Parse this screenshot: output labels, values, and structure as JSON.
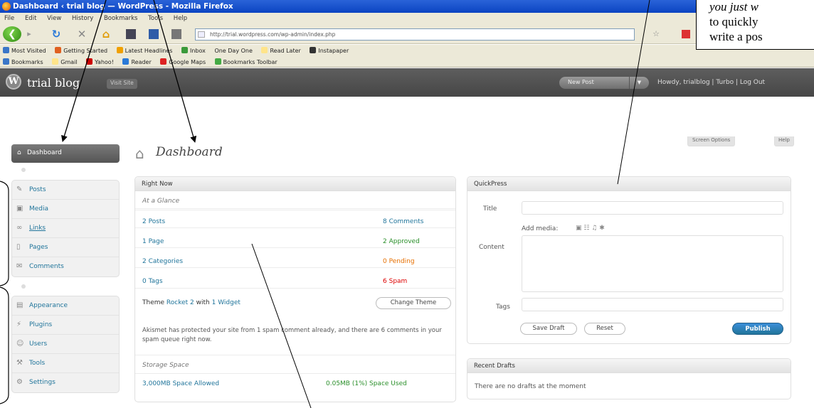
{
  "browser": {
    "title": "Dashboard ‹ trial blog — WordPress - Mozilla Firefox",
    "menu": [
      "File",
      "Edit",
      "View",
      "History",
      "Bookmarks",
      "Tools",
      "Help"
    ],
    "url": "http://trial.wordpress.com/wp-admin/index.php",
    "bookmarks_row1": [
      "Most Visited",
      "Getting Started",
      "Latest Headlines",
      "Inbox",
      "One Day One",
      "Read Later",
      "Instapaper"
    ],
    "bookmarks_row2": [
      "Bookmarks",
      "Gmail",
      "Yahoo!",
      "Reader",
      "Google Maps",
      "Bookmarks Toolbar"
    ]
  },
  "wp_header": {
    "logo": "W",
    "site_title": "trial blog",
    "visit_site": "Visit Site",
    "new_post": "New Post",
    "howdy": "Howdy, trialblog | Turbo | Log Out"
  },
  "sidebar": {
    "dashboard": "Dashboard",
    "group1": [
      {
        "label": "Posts",
        "icon": "pin-icon"
      },
      {
        "label": "Media",
        "icon": "media-icon"
      },
      {
        "label": "Links",
        "icon": "links-icon"
      },
      {
        "label": "Pages",
        "icon": "pages-icon"
      },
      {
        "label": "Comments",
        "icon": "comments-icon"
      }
    ],
    "group2": [
      {
        "label": "Appearance",
        "icon": "appearance-icon"
      },
      {
        "label": "Plugins",
        "icon": "plugins-icon"
      },
      {
        "label": "Users",
        "icon": "users-icon"
      },
      {
        "label": "Tools",
        "icon": "tools-icon"
      },
      {
        "label": "Settings",
        "icon": "settings-icon"
      }
    ]
  },
  "page": {
    "title": "Dashboard",
    "screen_options": "Screen Options",
    "help": "Help"
  },
  "right_now": {
    "title": "Right Now",
    "subtitle": "At a Glance",
    "content": [
      {
        "count": "2",
        "label": "Posts"
      },
      {
        "count": "1",
        "label": "Page"
      },
      {
        "count": "2",
        "label": "Categories"
      },
      {
        "count": "0",
        "label": "Tags"
      }
    ],
    "discussion": [
      {
        "count": "8",
        "label": "Comments"
      },
      {
        "count": "2",
        "label": "Approved"
      },
      {
        "count": "0",
        "label": "Pending"
      },
      {
        "count": "6",
        "label": "Spam"
      }
    ],
    "theme_prefix": "Theme",
    "theme_name": "Rocket 2",
    "theme_with": "with",
    "theme_widgets": "1 Widget",
    "change_theme": "Change Theme",
    "akismet": "Akismet has protected your site from 1 spam comment already, and there are 6 comments in your spam queue right now.",
    "storage_title": "Storage Space",
    "storage_allowed": "3,000MB Space Allowed",
    "storage_used": "0.05MB (1%) Space Used"
  },
  "quickpress": {
    "title": "QuickPress",
    "title_label": "Title",
    "upload_label": "Add media:",
    "content_label": "Content",
    "tags_label": "Tags",
    "save_draft": "Save Draft",
    "reset": "Reset",
    "publish": "Publish"
  },
  "recent_drafts": {
    "title": "Recent Drafts",
    "message": "There are no drafts at the moment"
  },
  "annotation": {
    "lines": [
      "you just w",
      "to quickly",
      "write a pos"
    ]
  }
}
